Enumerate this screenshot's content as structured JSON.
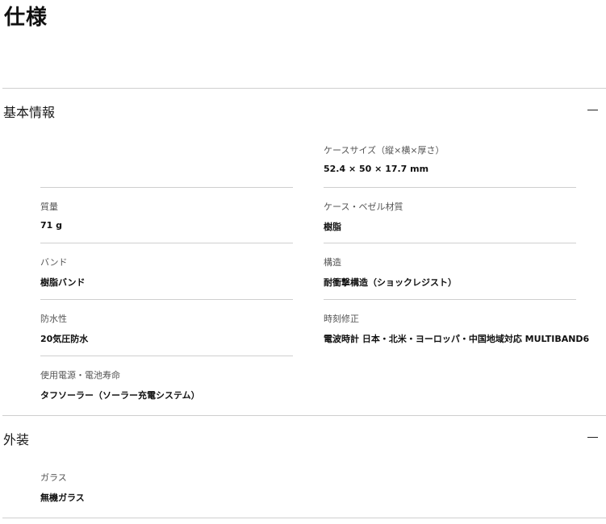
{
  "page": {
    "title": "仕様"
  },
  "sections": [
    {
      "title": "基本情報",
      "items": [
        {
          "label": "ケースサイズ（縦×横×厚さ）",
          "value": "52.4 × 50 × 17.7 mm"
        },
        {
          "label": "質量",
          "value": "71 g"
        },
        {
          "label": "ケース・ベゼル材質",
          "value": "樹脂"
        },
        {
          "label": "バンド",
          "value": "樹脂バンド"
        },
        {
          "label": "構造",
          "value": "耐衝撃構造（ショックレジスト）"
        },
        {
          "label": "防水性",
          "value": "20気圧防水"
        },
        {
          "label": "時刻修正",
          "value": "電波時計 日本・北米・ヨーロッパ・中国地域対応 MULTIBAND6"
        },
        {
          "label": "使用電源・電池寿命",
          "value": "タフソーラー（ソーラー充電システム）"
        }
      ]
    },
    {
      "title": "外装",
      "items": [
        {
          "label": "ガラス",
          "value": "無機ガラス"
        }
      ]
    }
  ]
}
